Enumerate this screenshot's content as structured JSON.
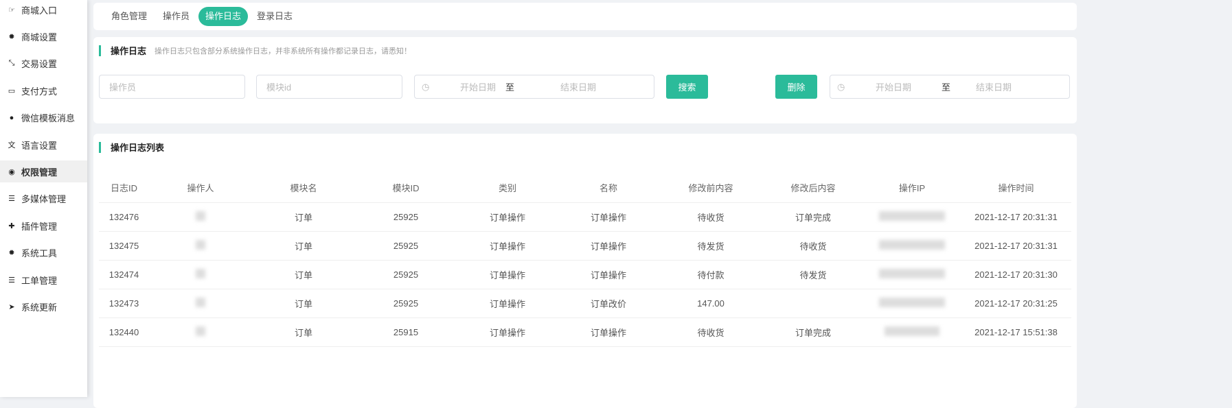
{
  "sidebar": {
    "items": [
      {
        "label": "商城入口",
        "icon": "hand-pointer-icon"
      },
      {
        "label": "商城设置",
        "icon": "gear-icon"
      },
      {
        "label": "交易设置",
        "icon": "compress-icon"
      },
      {
        "label": "支付方式",
        "icon": "credit-card-icon"
      },
      {
        "label": "微信模板消息",
        "icon": "wechat-icon"
      },
      {
        "label": "语言设置",
        "icon": "language-icon"
      },
      {
        "label": "权限管理",
        "icon": "gamepad-icon"
      },
      {
        "label": "多媒体管理",
        "icon": "list-icon"
      },
      {
        "label": "插件管理",
        "icon": "puzzle-icon"
      },
      {
        "label": "系统工具",
        "icon": "gear-icon"
      },
      {
        "label": "工单管理",
        "icon": "list-icon"
      },
      {
        "label": "系统更新",
        "icon": "paper-plane-icon"
      }
    ],
    "active": 6
  },
  "tabs": [
    "角色管理",
    "操作员",
    "操作日志",
    "登录日志"
  ],
  "filter": {
    "title": "操作日志",
    "hint": "操作日志只包含部分系统操作日志，并非系统所有操作都记录日志，请悉知！",
    "operator_placeholder": "操作员",
    "module_placeholder": "模块id",
    "start_placeholder": "开始日期",
    "separator": "至",
    "end_placeholder": "结束日期",
    "search_label": "搜索",
    "delete_label": "删除"
  },
  "list": {
    "title": "操作日志列表",
    "columns": [
      "日志ID",
      "操作人",
      "模块名",
      "模块ID",
      "类别",
      "名称",
      "修改前内容",
      "修改后内容",
      "操作IP",
      "操作时间"
    ],
    "rows": [
      {
        "id": "132476",
        "module": "订单",
        "module_id": "25925",
        "type": "订单操作",
        "name": "订单操作",
        "before": "待收货",
        "after": "订单完成",
        "time": "2021-12-17 20:31:31"
      },
      {
        "id": "132475",
        "module": "订单",
        "module_id": "25925",
        "type": "订单操作",
        "name": "订单操作",
        "before": "待发货",
        "after": "待收货",
        "time": "2021-12-17 20:31:31"
      },
      {
        "id": "132474",
        "module": "订单",
        "module_id": "25925",
        "type": "订单操作",
        "name": "订单操作",
        "before": "待付款",
        "after": "待发货",
        "time": "2021-12-17 20:31:30"
      },
      {
        "id": "132473",
        "module": "订单",
        "module_id": "25925",
        "type": "订单操作",
        "name": "订单改价",
        "before": "147.00",
        "after": "",
        "time": "2021-12-17 20:31:25"
      },
      {
        "id": "132440",
        "module": "订单",
        "module_id": "25915",
        "type": "订单操作",
        "name": "订单操作",
        "before": "待收货",
        "after": "订单完成",
        "time": "2021-12-17 15:51:38"
      }
    ]
  }
}
